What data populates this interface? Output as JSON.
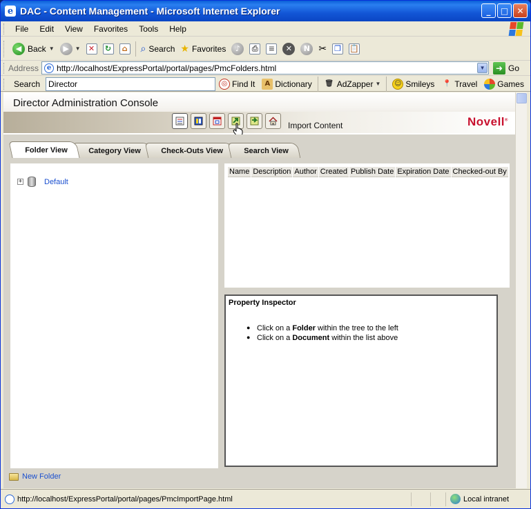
{
  "window": {
    "title": "DAC - Content Management - Microsoft Internet Explorer",
    "buttons": {
      "minimize": "_",
      "maximize": "□",
      "close": "✕"
    }
  },
  "menu": [
    "File",
    "Edit",
    "View",
    "Favorites",
    "Tools",
    "Help"
  ],
  "toolbar": {
    "back_label": "Back",
    "search_label": "Search",
    "favorites_label": "Favorites"
  },
  "address": {
    "label": "Address",
    "url": "http://localhost/ExpressPortal/portal/pages/PmcFolders.html",
    "go_label": "Go"
  },
  "searchbar": {
    "label": "Search",
    "query": "Director",
    "find_it": "Find It",
    "dictionary": "Dictionary",
    "adzapper": "AdZapper",
    "smileys": "Smileys",
    "travel": "Travel",
    "games": "Games"
  },
  "console": {
    "title": "Director Administration Console",
    "import_label": "Import Content",
    "brand": "Novell"
  },
  "tabs": [
    {
      "label": "Folder View"
    },
    {
      "label": "Category View"
    },
    {
      "label": "Check-Outs View"
    },
    {
      "label": "Search View"
    }
  ],
  "tree": {
    "root_label": "Default"
  },
  "list": {
    "columns": [
      "Name",
      "Description",
      "Author",
      "Created",
      "Publish Date",
      "Expiration Date",
      "Checked-out By"
    ]
  },
  "inspector": {
    "title": "Property Inspector",
    "items": [
      {
        "pre": "Click on a ",
        "bold": "Folder",
        "post": " within the tree to the left"
      },
      {
        "pre": "Click on a ",
        "bold": "Document",
        "post": " within the list above"
      }
    ]
  },
  "new_folder_label": "New Folder",
  "status": {
    "url": "http://localhost/ExpressPortal/portal/pages/PmcImportPage.html",
    "zone": "Local intranet"
  }
}
